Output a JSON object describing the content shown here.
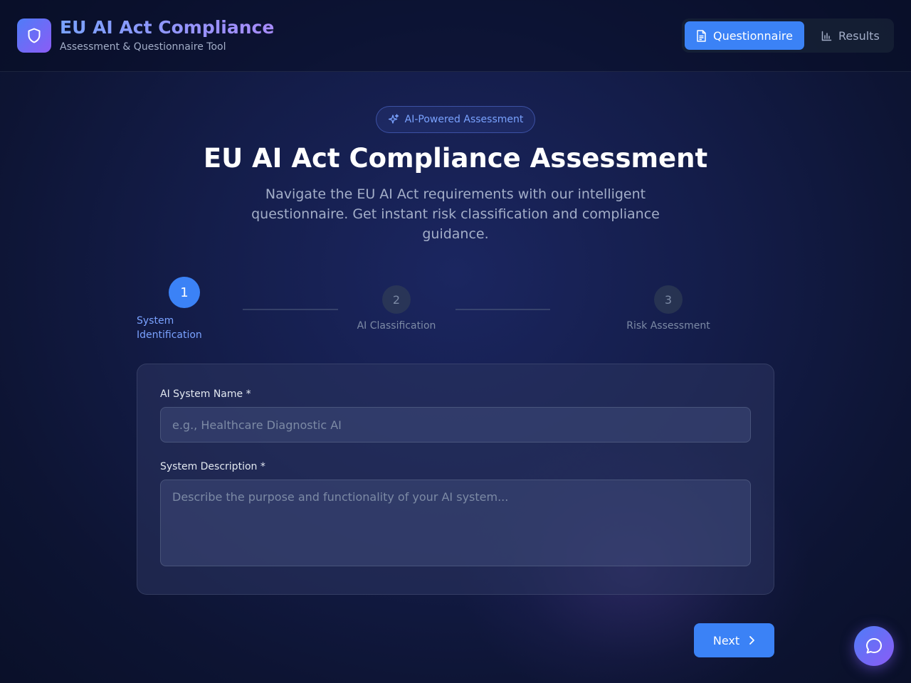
{
  "header": {
    "title": "EU AI Act Compliance",
    "subtitle": "Assessment & Questionnaire Tool",
    "logo_icon": "shield-icon",
    "nav": [
      {
        "label": "Questionnaire",
        "icon": "document-icon",
        "active": true
      },
      {
        "label": "Results",
        "icon": "bar-chart-icon",
        "active": false
      }
    ]
  },
  "hero": {
    "badge": "AI-Powered Assessment",
    "badge_icon": "sparkles-icon",
    "title": "EU AI Act Compliance Assessment",
    "description": "Navigate the EU AI Act requirements with our intelligent questionnaire. Get instant risk classification and compliance guidance."
  },
  "steps": [
    {
      "number": "1",
      "label": "System Identification",
      "active": true
    },
    {
      "number": "2",
      "label": "AI Classification",
      "active": false
    },
    {
      "number": "3",
      "label": "Risk Assessment",
      "active": false
    }
  ],
  "form": {
    "name_label": "AI System Name *",
    "name_placeholder": "e.g., Healthcare Diagnostic AI",
    "name_value": "",
    "description_label": "System Description *",
    "description_placeholder": "Describe the purpose and functionality of your AI system...",
    "description_value": ""
  },
  "actions": {
    "next_label": "Next"
  },
  "colors": {
    "accent": "#3b82f6",
    "gradient_start": "#4f7cf7",
    "gradient_end": "#8b5cf6",
    "background": "#141d4a"
  }
}
